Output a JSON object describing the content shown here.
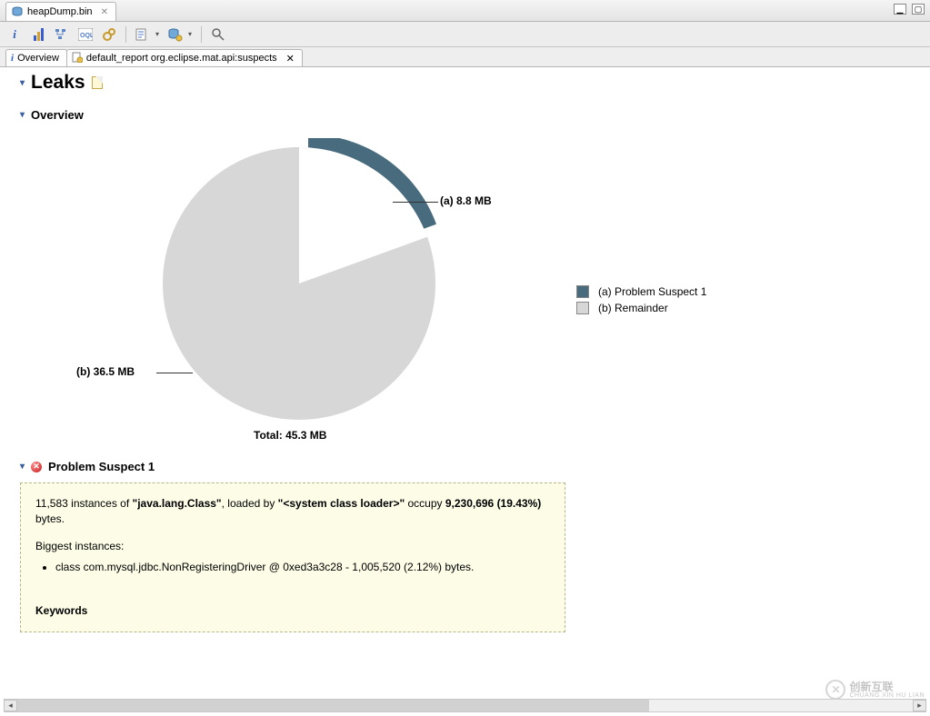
{
  "editor_tab": {
    "title": "heapDump.bin"
  },
  "subtabs": {
    "overview": "Overview",
    "report": "default_report  org.eclipse.mat.api:suspects"
  },
  "page": {
    "title": "Leaks",
    "overview_heading": "Overview",
    "suspect_heading": "Problem Suspect 1"
  },
  "chart_data": {
    "type": "pie",
    "title": "",
    "total_label": "Total: 45.3 MB",
    "slices": [
      {
        "key": "a",
        "label": "(a)  8.8 MB",
        "value_mb": 8.8,
        "degrees": 70,
        "color": "#486b7e",
        "legend": "(a)  Problem Suspect 1"
      },
      {
        "key": "b",
        "label": "(b)  36.5 MB",
        "value_mb": 36.5,
        "degrees": 290,
        "color": "#d7d7d7",
        "legend": "(b)  Remainder"
      }
    ]
  },
  "suspect": {
    "line1_prefix": "11,583 instances of ",
    "line1_class": "\"java.lang.Class\"",
    "line1_mid": ", loaded by ",
    "line1_loader": "\"<system class loader>\"",
    "line1_suffix": " occupy ",
    "line1_bytes": "9,230,696 (19.43%)",
    "line1_end": " bytes.",
    "biggest_heading": "Biggest instances:",
    "biggest_items": [
      "class com.mysql.jdbc.NonRegisteringDriver @ 0xed3a3c28 - 1,005,520 (2.12%) bytes."
    ],
    "keywords_heading": "Keywords"
  },
  "watermark": "创新互联",
  "watermark_sub": "CHUANG XIN HU LIAN"
}
